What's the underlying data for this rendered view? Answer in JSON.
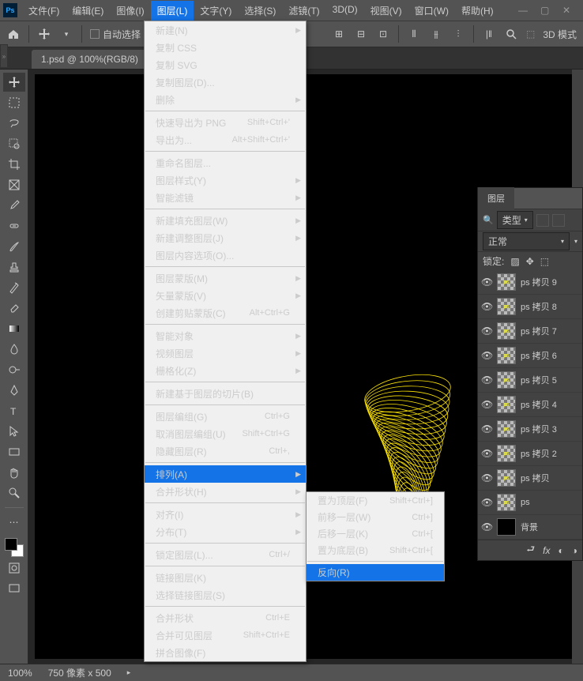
{
  "menubar": [
    "文件(F)",
    "编辑(E)",
    "图像(I)",
    "图层(L)",
    "文字(Y)",
    "选择(S)",
    "滤镜(T)",
    "3D(D)",
    "视图(V)",
    "窗口(W)",
    "帮助(H)"
  ],
  "toolbar": {
    "autoselect": "自动选择",
    "mode3d": "3D 模式"
  },
  "doc": {
    "title": "1.psd @ 100%(RGB/8)"
  },
  "dropdown": [
    {
      "t": "新建(N)",
      "arrow": true
    },
    {
      "t": "复制 CSS",
      "disabled": true
    },
    {
      "t": "复制 SVG",
      "disabled": true
    },
    {
      "t": "复制图层(D)..."
    },
    {
      "t": "删除",
      "arrow": true
    },
    {
      "sep": true
    },
    {
      "t": "快速导出为 PNG",
      "sc": "Shift+Ctrl+'"
    },
    {
      "t": "导出为...",
      "sc": "Alt+Shift+Ctrl+'"
    },
    {
      "sep": true
    },
    {
      "t": "重命名图层..."
    },
    {
      "t": "图层样式(Y)",
      "arrow": true
    },
    {
      "t": "智能滤镜",
      "disabled": true,
      "arrow": true
    },
    {
      "sep": true
    },
    {
      "t": "新建填充图层(W)",
      "arrow": true
    },
    {
      "t": "新建调整图层(J)",
      "arrow": true
    },
    {
      "t": "图层内容选项(O)...",
      "disabled": true
    },
    {
      "sep": true
    },
    {
      "t": "图层蒙版(M)",
      "disabled": true,
      "arrow": true
    },
    {
      "t": "矢量蒙版(V)",
      "disabled": true,
      "arrow": true
    },
    {
      "t": "创建剪贴蒙版(C)",
      "sc": "Alt+Ctrl+G"
    },
    {
      "sep": true
    },
    {
      "t": "智能对象",
      "arrow": true
    },
    {
      "t": "视频图层",
      "arrow": true
    },
    {
      "t": "栅格化(Z)",
      "arrow": true
    },
    {
      "sep": true
    },
    {
      "t": "新建基于图层的切片(B)"
    },
    {
      "sep": true
    },
    {
      "t": "图层编组(G)",
      "sc": "Ctrl+G"
    },
    {
      "t": "取消图层编组(U)",
      "sc": "Shift+Ctrl+G",
      "disabled": true
    },
    {
      "t": "隐藏图层(R)",
      "sc": "Ctrl+,"
    },
    {
      "sep": true
    },
    {
      "t": "排列(A)",
      "arrow": true,
      "highlight": true
    },
    {
      "t": "合并形状(H)",
      "disabled": true,
      "arrow": true
    },
    {
      "sep": true
    },
    {
      "t": "对齐(I)",
      "arrow": true
    },
    {
      "t": "分布(T)",
      "disabled": true,
      "arrow": true
    },
    {
      "sep": true
    },
    {
      "t": "锁定图层(L)...",
      "sc": "Ctrl+/"
    },
    {
      "sep": true
    },
    {
      "t": "链接图层(K)"
    },
    {
      "t": "选择链接图层(S)",
      "disabled": true
    },
    {
      "sep": true
    },
    {
      "t": "合并形状",
      "sc": "Ctrl+E"
    },
    {
      "t": "合并可见图层",
      "sc": "Shift+Ctrl+E"
    },
    {
      "t": "拼合图像(F)"
    }
  ],
  "submenu": [
    {
      "t": "置为顶层(F)",
      "sc": "Shift+Ctrl+]"
    },
    {
      "t": "前移一层(W)",
      "sc": "Ctrl+]"
    },
    {
      "t": "后移一层(K)",
      "sc": "Ctrl+["
    },
    {
      "t": "置为底层(B)",
      "sc": "Shift+Ctrl+["
    },
    {
      "sep": true
    },
    {
      "t": "反向(R)",
      "highlight": true
    }
  ],
  "layersPanel": {
    "tab": "图层",
    "filterLabel": "类型",
    "blend": "正常",
    "lockLabel": "锁定:",
    "layers": [
      {
        "name": "ps 拷贝 9",
        "ps": true
      },
      {
        "name": "ps 拷贝 8",
        "ps": true
      },
      {
        "name": "ps 拷贝 7",
        "ps": true
      },
      {
        "name": "ps 拷贝 6",
        "ps": true
      },
      {
        "name": "ps 拷贝 5",
        "ps": true
      },
      {
        "name": "ps 拷贝 4",
        "ps": true
      },
      {
        "name": "ps 拷贝 3",
        "ps": true
      },
      {
        "name": "ps 拷贝 2",
        "ps": true
      },
      {
        "name": "ps 拷贝",
        "ps": true
      },
      {
        "name": "ps",
        "ps": true
      },
      {
        "name": "背景",
        "bg": true
      }
    ]
  },
  "status": {
    "zoom": "100%",
    "dims": "750 像素 x 500"
  }
}
